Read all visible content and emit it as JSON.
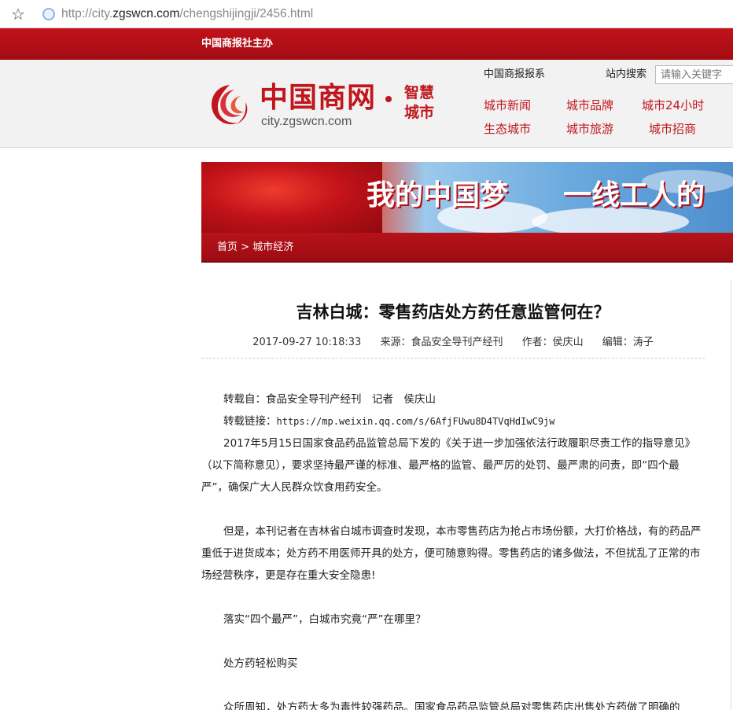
{
  "browser": {
    "url_prefix": "http://city.",
    "url_domain": "zgswcn.com",
    "url_path": "/chengshijingji/2456.html"
  },
  "topbar": {
    "sponsor": "中国商报社主办"
  },
  "header": {
    "logo_main": "中国商网",
    "logo_url": "city.zgswcn.com",
    "logo_sub": "智慧城市",
    "newspaper_link": "中国商报报系",
    "search_label": "站内搜索",
    "search_placeholder": "请输入关键字",
    "nav": [
      "城市新闻",
      "城市品牌",
      "城市24小时",
      "生态城市",
      "城市旅游",
      "城市招商"
    ]
  },
  "banner": {
    "text1": "我的中国梦",
    "text2": "一线工人的"
  },
  "breadcrumb": {
    "home": "首页",
    "sep": ">",
    "section": "城市经济"
  },
  "article": {
    "title": "吉林白城：零售药店处方药任意监管何在？",
    "datetime": "2017-09-27 10:18:33",
    "source": "来源：食品安全导刊产经刊",
    "author": "作者：侯庆山",
    "editor": "编辑：涛子",
    "repost_from": "转载自：食品安全导刊产经刊　记者　侯庆山",
    "repost_link_label": "转载链接：",
    "repost_link": "https://mp.weixin.qq.com/s/6AfjFUwu8D4TVqHdIwC9jw",
    "para1": "2017年5月15日国家食品药品监管总局下发的《关于进一步加强依法行政履职尽责工作的指导意见》（以下简称意见），要求坚持最严谨的标准、最严格的监管、最严厉的处罚、最严肃的问责，即“四个最严”，确保广大人民群众饮食用药安全。",
    "para2": "但是，本刊记者在吉林省白城市调查时发现，本市零售药店为抢占市场份额，大打价格战，有的药品严重低于进货成本；处方药不用医师开具的处方，便可随意购得。零售药店的诸多做法，不但扰乱了正常的市场经营秩序，更是存在重大安全隐患!",
    "para3": "落实“四个最严”，白城市究竟“严”在哪里？",
    "subhead": "处方药轻松购买",
    "para4": "众所周知，处方药大多为毒性较强药品。国家食品药品监管总局对零售药店出售处方药做了明确的"
  }
}
